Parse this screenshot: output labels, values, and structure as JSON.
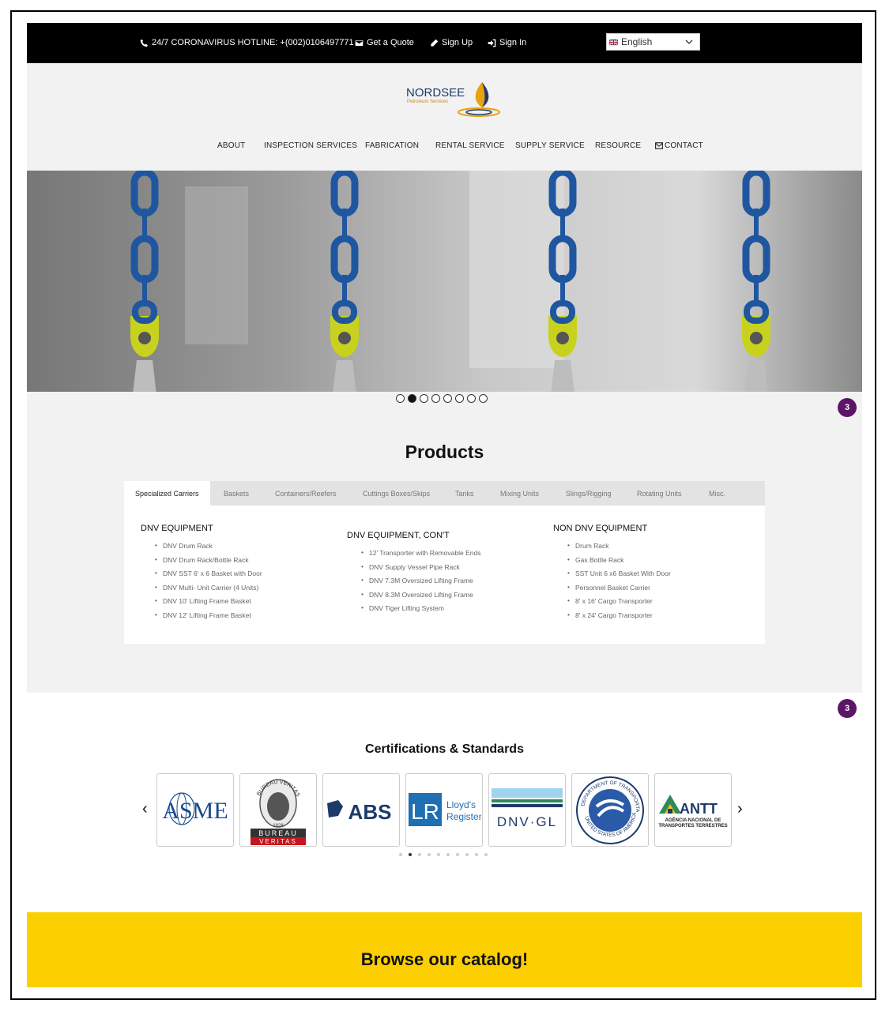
{
  "topbar": {
    "hotline": "24/7 CORONAVIRUS HOTLINE: +(002)0106497771",
    "quote": "Get a Quote",
    "signup": "Sign Up",
    "signin": "Sign In",
    "language": "English"
  },
  "brand": {
    "name": "NORDSEE",
    "tagline": "Petroleum Services"
  },
  "nav": {
    "about": "ABOUT",
    "inspection": "INSPECTION SERVICES",
    "fabrication": "FABRICATION",
    "rental": "RENTAL SERVICE",
    "supply": "SUPPLY SERVICE",
    "resource": "RESOURCE",
    "contact": "CONTACT"
  },
  "slider": {
    "count": 8,
    "active": 2
  },
  "badges": {
    "first": "3",
    "second": "3"
  },
  "products": {
    "title": "Products",
    "tabs": [
      "Specialized Carriers",
      "Baskets",
      "Containers/Reefers",
      "Cuttings Boxes/Skips",
      "Tanks",
      "Mixing Units",
      "Slings/Rigging",
      "Rotating Units",
      "Misc."
    ],
    "active_tab": 0,
    "columns": [
      {
        "heading": "DNV EQUIPMENT",
        "items": [
          "DNV Drum Rack",
          "DNV Drum Rack/Bottle Rack",
          "DNV SST  6' x 6  Basket with Door",
          "DNV Multi- Unit Carrier (4 Units)",
          "DNV 10' Lifting Frame Basket",
          "DNV 12' Lifting Frame Basket"
        ]
      },
      {
        "heading": "DNV EQUIPMENT, CON'T",
        "items": [
          "12'  Transporter with Removable Ends",
          "DNV Supply Vessel Pipe Rack",
          "DNV 7.3M Oversized Lifting Frame",
          "DNV 8.3M Oversized Lifting Frame",
          "DNV Tiger  Lifting System"
        ]
      },
      {
        "heading": "NON DNV EQUIPMENT",
        "items": [
          "Drum Rack",
          "Gas Bottle Rack",
          "SST Unit 6 x6 Basket With Door",
          "Personnel Basket Carrier",
          "8' x 16' Cargo Transporter",
          "8' x 24' Cargo Transporter"
        ]
      }
    ]
  },
  "certifications": {
    "title": "Certifications & Standards",
    "logos": [
      {
        "name": "ASME",
        "text": "ASME"
      },
      {
        "name": "Bureau Veritas",
        "text": "BUREAU",
        "text2": "VERITAS",
        "year": "1828",
        "ring": "BUREAU VERITAS"
      },
      {
        "name": "ABS",
        "text": "ABS"
      },
      {
        "name": "Lloyd's Register",
        "mark": "LR",
        "text": "Lloyd's",
        "text2": "Register"
      },
      {
        "name": "DNV GL",
        "text": "DNV·GL"
      },
      {
        "name": "US Department of Transportation",
        "ring_top": "DEPARTMENT OF TRANSPORTATION",
        "ring_bottom": "UNITED STATES OF AMERICA"
      },
      {
        "name": "ANTT",
        "text": "ANTT",
        "text2": "AGÊNCIA NACIONAL DE",
        "text3": "TRANSPORTES TERRESTRES"
      }
    ],
    "dots": 10,
    "active_dot": 1
  },
  "catalog": {
    "text": "Browse our catalog!"
  },
  "colors": {
    "topbar": "#000000",
    "header_bg": "#f2f2f2",
    "badge": "#5b1666",
    "catalog": "#fccf00",
    "chain_blue": "#1f56a0",
    "shackle_yellow": "#c8d21e"
  }
}
